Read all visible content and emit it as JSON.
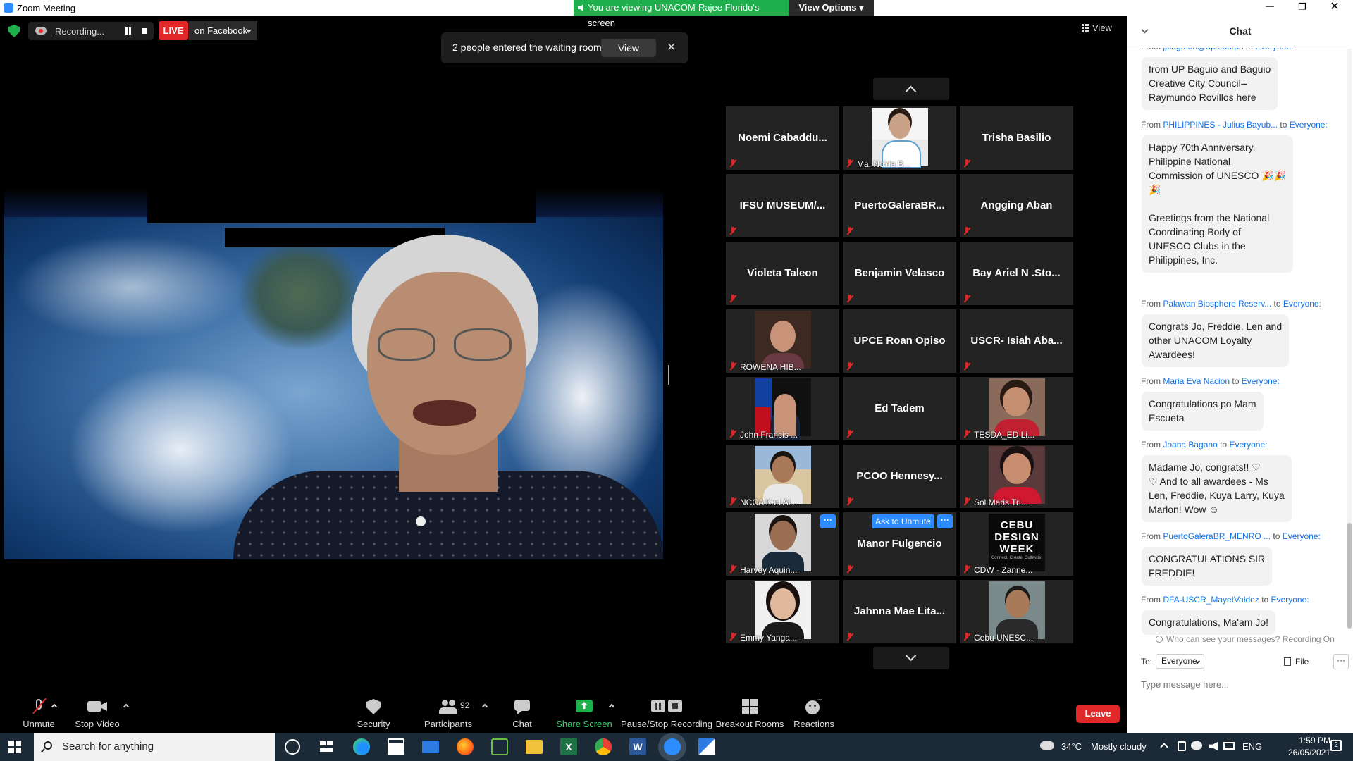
{
  "window": {
    "title": "Zoom Meeting",
    "minimize": "─",
    "restore": "❐",
    "close": "✕"
  },
  "share_banner": {
    "text": "You are viewing UNACOM-Rajee Florido's screen",
    "view_options": "View Options"
  },
  "top_bar": {
    "recording_label": "Recording...",
    "live_badge": "LIVE",
    "live_target": "on Facebook",
    "view_label": "View"
  },
  "waiting_room": {
    "message": "2 people entered the waiting room",
    "view_button": "View",
    "close": "✕"
  },
  "gallery": {
    "tiles": [
      {
        "name": "Noemi  Cabaddu...",
        "has_video": false
      },
      {
        "name": "Ma. Noida B...",
        "has_video": true,
        "photo": "p-lady"
      },
      {
        "name": "Trisha Basilio",
        "has_video": false
      },
      {
        "name": "IFSU  MUSEUM/...",
        "has_video": false
      },
      {
        "name": "PuertoGaleraBR...",
        "has_video": false
      },
      {
        "name": "Angging Aban",
        "has_video": false
      },
      {
        "name": "Violeta Taleon",
        "has_video": false
      },
      {
        "name": "Benjamin Velasco",
        "has_video": false
      },
      {
        "name": "Bay Ariel N .Sto...",
        "has_video": false
      },
      {
        "name": "ROWENA HIB...",
        "has_video": true,
        "photo": "p-girl"
      },
      {
        "name": "UPCE Roan Opiso",
        "has_video": false
      },
      {
        "name": "USCR- Isiah Aba...",
        "has_video": false
      },
      {
        "name": "John Francis ...",
        "has_video": true,
        "photo": "p-flag"
      },
      {
        "name": "Ed Tadem",
        "has_video": false
      },
      {
        "name": "TESDA_ED Li...",
        "has_video": true,
        "photo": "p-red"
      },
      {
        "name": "NCCA Karl Al...",
        "has_video": true,
        "photo": "p-beach"
      },
      {
        "name": "PCOO  Hennesy...",
        "has_video": false
      },
      {
        "name": "Sol Maris Tri...",
        "has_video": true,
        "photo": "p-red2"
      },
      {
        "name": "Harvey Aquin...",
        "has_video": true,
        "photo": "p-man"
      },
      {
        "name": "Manor Fulgencio",
        "has_video": false
      },
      {
        "name": "CDW - Zanne...",
        "has_video": true,
        "photo": "p-cdw"
      },
      {
        "name": "Emmy Yanga...",
        "has_video": true,
        "photo": "p-emmy"
      },
      {
        "name": "Jahnna Mae Lita...",
        "has_video": false
      },
      {
        "name": "Cebu UNESC...",
        "has_video": true,
        "photo": "p-cebu"
      }
    ],
    "ask_to_unmute": "Ask to Unmute",
    "more_dots": "···",
    "cdw_logo": {
      "line1": "CEBU",
      "line2": "DESIGN",
      "line3": "WEEK",
      "tagline": "Connect. Create. Cultivate."
    }
  },
  "chat": {
    "header": "Chat",
    "messages": [
      {
        "from": "jpiagman@up.edu.ph",
        "to": "Everyone:",
        "text": "from UP Baguio and Baguio\nCreative City Council--\nRaymundo Rovillos here"
      },
      {
        "from": "PHILIPPINES - Julius Bayub...",
        "to": "Everyone:",
        "text": "Happy 70th Anniversary,\nPhilippine National\nCommission of UNESCO 🎉🎉\n🎉\n\nGreetings from the National\nCoordinating Body of\nUNESCO Clubs in the\nPhilippines, Inc."
      },
      {
        "from": "Palawan Biosphere Reserv...",
        "to": "Everyone:",
        "text": "Congrats Jo, Freddie, Len and\nother UNACOM Loyalty\nAwardees!"
      },
      {
        "from": "Maria Eva Nacion",
        "to": "Everyone:",
        "text": "Congratulations po Mam\nEscueta"
      },
      {
        "from": "Joana Bagano",
        "to": "Everyone:",
        "text": "Madame Jo, congrats!! ♡\n♡ And to all awardees - Ms\nLen, Freddie, Kuya Larry, Kuya\nMarlon! Wow ☺"
      },
      {
        "from": "PuertoGaleraBR_MENRO ...",
        "to": "Everyone:",
        "text": "CONGRATULATIONS SIR\nFREDDIE!"
      },
      {
        "from": "DFA-USCR_MayetValdez",
        "to": "Everyone:",
        "text": "Congratulations, Ma'am Jo!"
      }
    ],
    "from_word": "From",
    "to_word": "to",
    "privacy_note": "Who can see your messages? Recording On",
    "to_label": "To:",
    "recipient": "Everyone",
    "file_label": "File",
    "more": "···",
    "input_placeholder": "Type message here..."
  },
  "toolbar": {
    "unmute": "Unmute",
    "stop_video": "Stop Video",
    "security": "Security",
    "participants": "Participants",
    "participants_count": "92",
    "chat": "Chat",
    "share_screen": "Share Screen",
    "recording": "Pause/Stop Recording",
    "breakout_rooms": "Breakout Rooms",
    "reactions": "Reactions",
    "leave": "Leave"
  },
  "taskbar": {
    "search_placeholder": "Search for anything",
    "weather_temp": "34°C",
    "weather_text": "Mostly cloudy",
    "language": "ENG",
    "time": "1:59 PM",
    "date": "26/05/2021",
    "notifications": "2"
  },
  "colors": {
    "zoom_blue": "#2d8cff",
    "share_green": "#1fae4c",
    "leave_red": "#e02828",
    "link_blue": "#0e72ed"
  }
}
